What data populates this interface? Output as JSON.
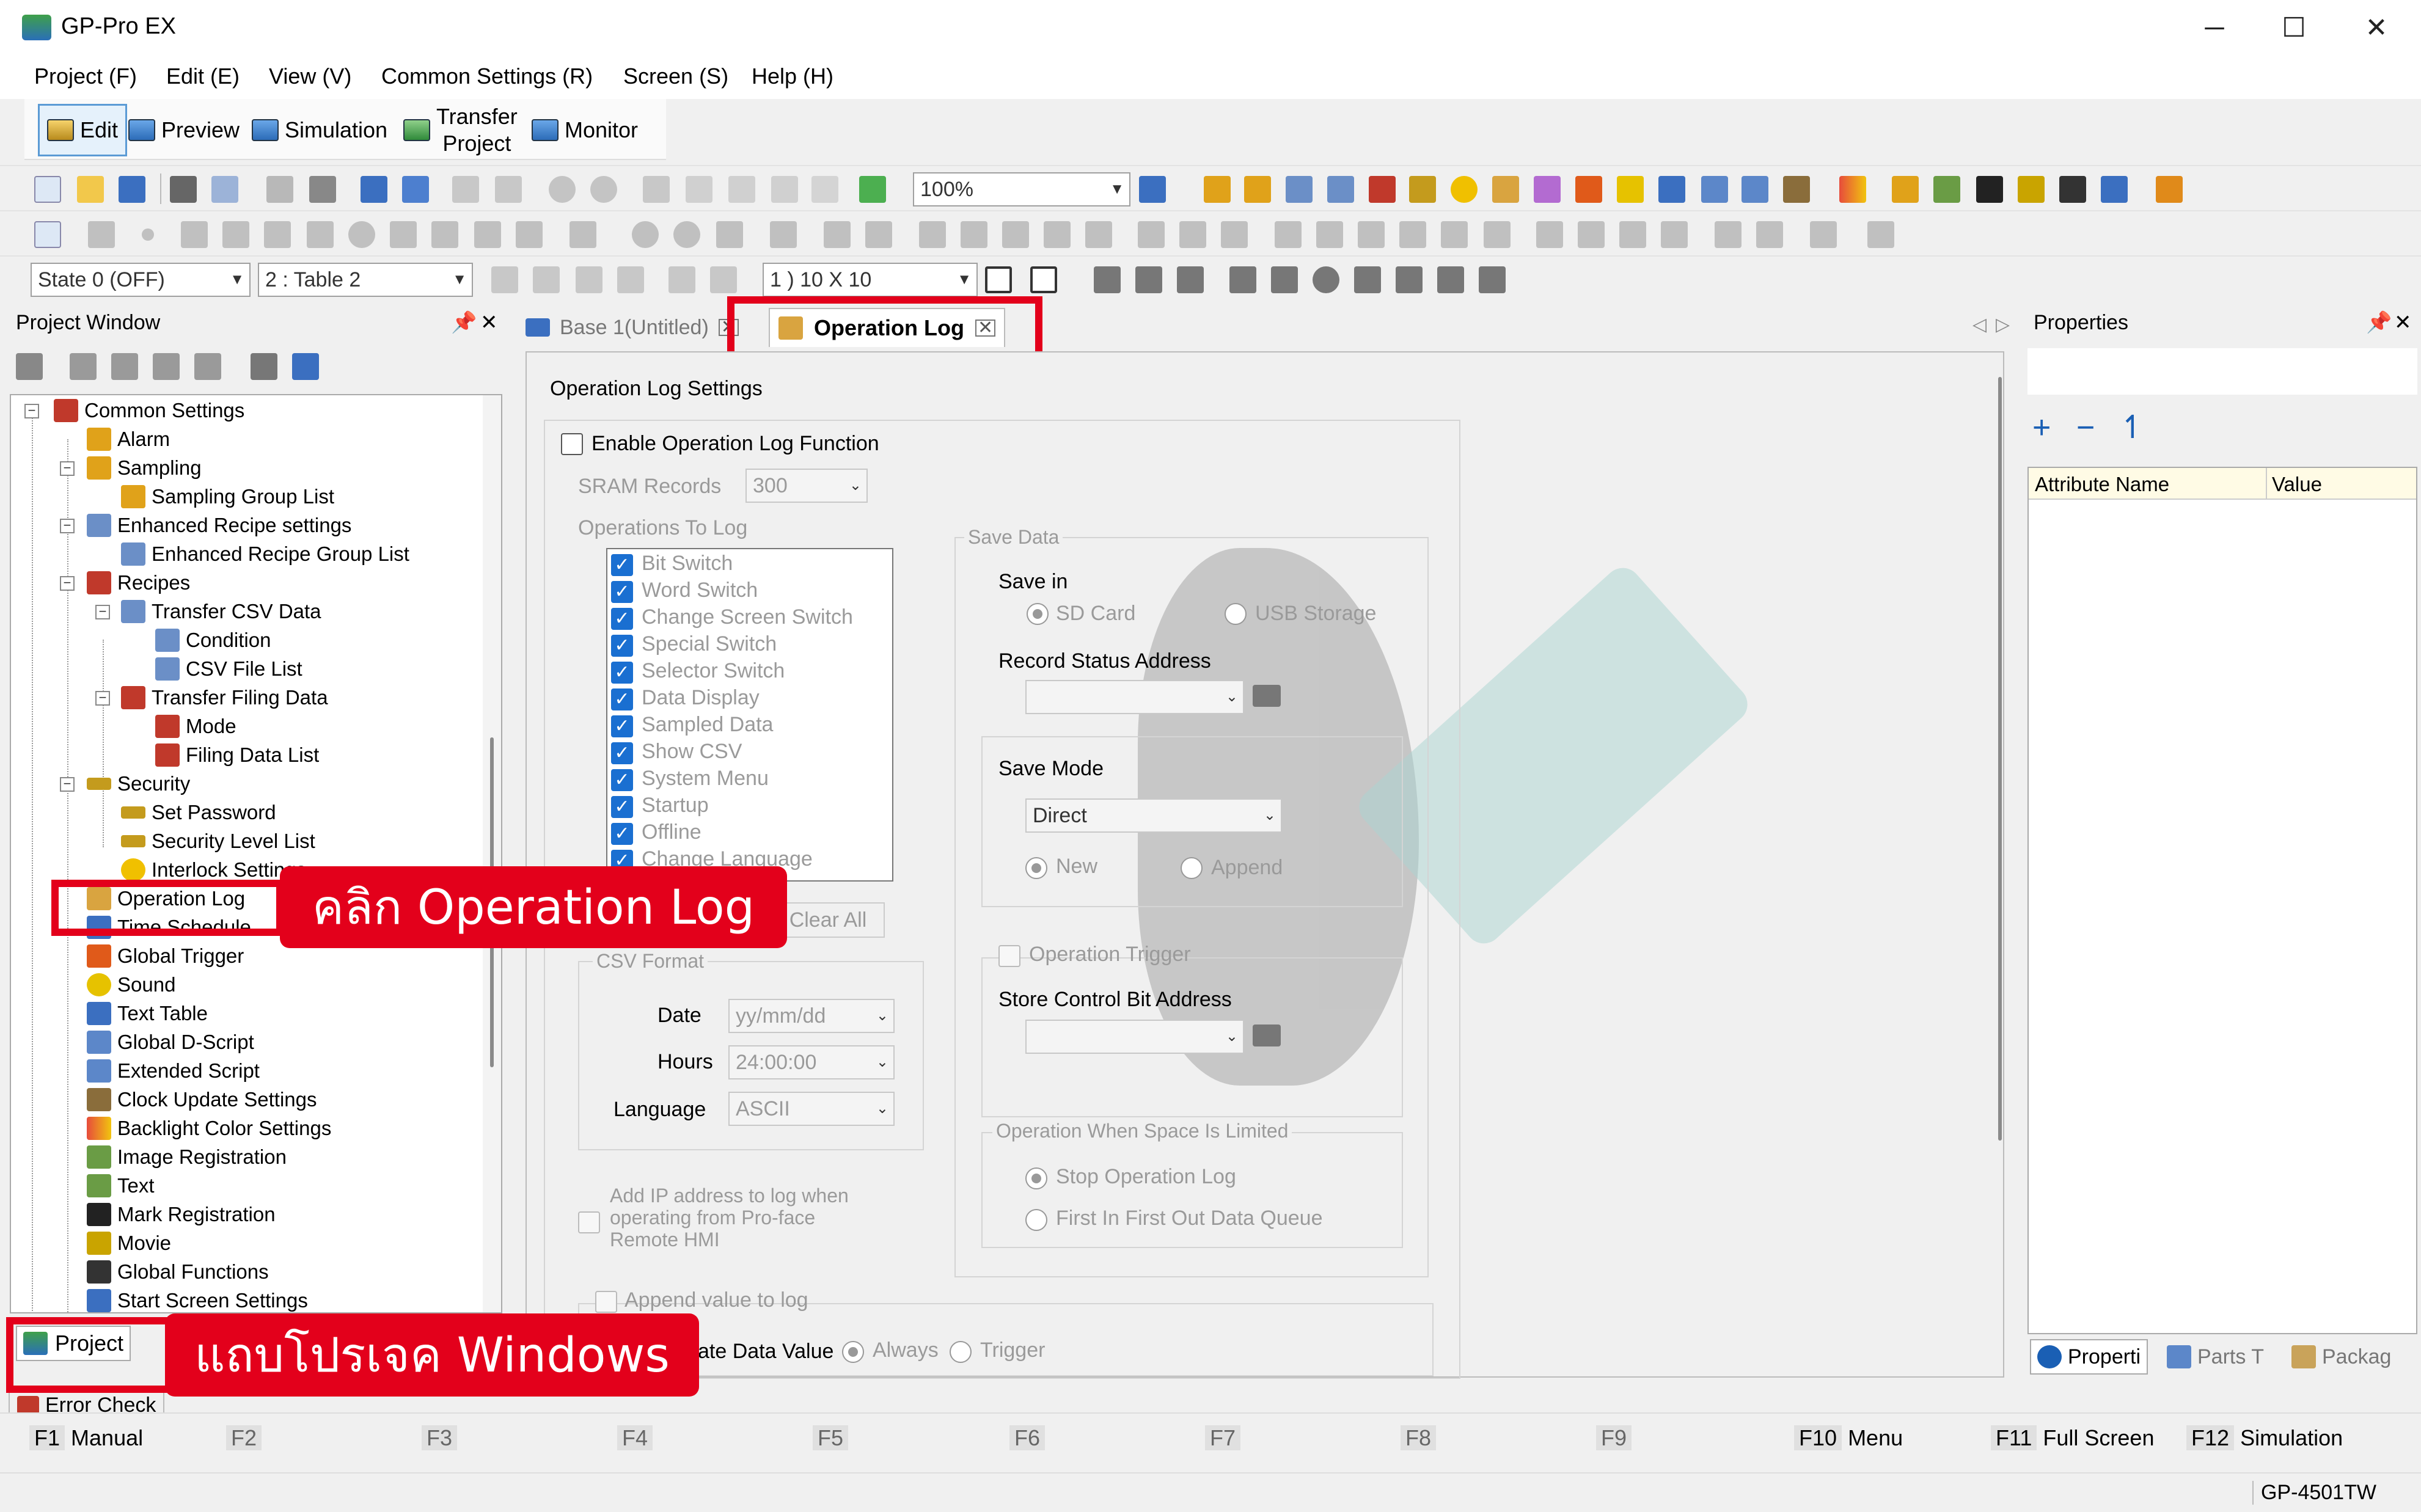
{
  "app": {
    "title": "GP-Pro EX"
  },
  "window_controls": {
    "minimize": "─",
    "maximize": "☐",
    "close": "✕"
  },
  "menu": [
    "Project (F)",
    "Edit (E)",
    "View (V)",
    "Common Settings (R)",
    "Screen (S)",
    "Help (H)"
  ],
  "modes": {
    "edit": "Edit",
    "preview": "Preview",
    "simulation": "Simulation",
    "transfer_1": "Transfer",
    "transfer_2": "Project",
    "monitor": "Monitor"
  },
  "toolbar": {
    "zoom": "100%",
    "state": "State 0 (OFF)",
    "table": "2 : Table 2",
    "grid": "1 ) 10 X 10"
  },
  "project_window": {
    "title": "Project Window",
    "tree": [
      "Common Settings",
      "Alarm",
      "Sampling",
      "Sampling Group List",
      "Enhanced Recipe settings",
      "Enhanced Recipe Group List",
      "Recipes",
      "Transfer CSV Data",
      "Condition",
      "CSV File List",
      "Transfer Filing Data",
      "Mode",
      "Filing Data List",
      "Security",
      "Set Password",
      "Security Level List",
      "Interlock Settings",
      "Operation Log",
      "Time Schedule",
      "Global Trigger",
      "Sound",
      "Text Table",
      "Global D-Script",
      "Extended Script",
      "Clock Update Settings",
      "Backlight Color Settings",
      "Image Registration",
      "Text",
      "Mark Registration",
      "Movie",
      "Global Functions",
      "Start Screen Settings"
    ],
    "bottom_tab": "Project",
    "error_check": "Error Check"
  },
  "tabs": {
    "base": "Base 1(Untitled)",
    "oplog": "Operation Log"
  },
  "oplog": {
    "heading": "Operation Log Settings",
    "enable": "Enable Operation Log Function",
    "sram_label": "SRAM Records",
    "sram_value": "300",
    "ops_label": "Operations To Log",
    "ops": [
      "Bit Switch",
      "Word Switch",
      "Change Screen Switch",
      "Special Switch",
      "Selector Switch",
      "Data Display",
      "Sampled Data",
      "Show CSV",
      "System Menu",
      "Startup",
      "Offline",
      "Change Language"
    ],
    "clear_all": "Clear All",
    "csv_format": "CSV Format",
    "date_label": "Date",
    "date_value": "yy/mm/dd",
    "hours_label": "Hours",
    "hours_value": "24:00:00",
    "lang_label": "Language",
    "lang_value": "ASCII",
    "add_ip": [
      "Add IP address to log when",
      "operating from Pro-face",
      "Remote HMI"
    ],
    "append": "Append value to log",
    "update_prefix": "ate Data Value",
    "always": "Always",
    "trigger": "Trigger",
    "save_data": "Save Data",
    "save_in": "Save in",
    "sd_card": "SD Card",
    "usb": "USB Storage",
    "record_status": "Record Status Address",
    "save_mode": "Save Mode",
    "save_mode_value": "Direct",
    "new": "New",
    "append_mode": "Append",
    "op_trigger": "Operation Trigger",
    "store_ctrl": "Store Control Bit Address",
    "space_limited": "Operation When Space Is Limited",
    "stop": "Stop Operation Log",
    "fifo": "First In First Out Data Queue"
  },
  "properties": {
    "title": "Properties",
    "col_name": "Attribute Name",
    "col_value": "Value",
    "tabs": [
      "Properti",
      "Parts T",
      "Packag"
    ]
  },
  "fkeys": [
    {
      "k": "F1",
      "l": "Manual"
    },
    {
      "k": "F2",
      "l": ""
    },
    {
      "k": "F3",
      "l": ""
    },
    {
      "k": "F4",
      "l": ""
    },
    {
      "k": "F5",
      "l": ""
    },
    {
      "k": "F6",
      "l": ""
    },
    {
      "k": "F7",
      "l": ""
    },
    {
      "k": "F8",
      "l": ""
    },
    {
      "k": "F9",
      "l": ""
    },
    {
      "k": "F10",
      "l": "Menu"
    },
    {
      "k": "F11",
      "l": "Full Screen"
    },
    {
      "k": "F12",
      "l": "Simulation"
    }
  ],
  "status": {
    "model": "GP-4501TW"
  },
  "callouts": {
    "click_oplog": "คลิก Operation Log",
    "project_bar": "แถบโปรเจค Windows"
  },
  "colors": {
    "callout": "#e3001b",
    "check": "#1a6fd1"
  }
}
